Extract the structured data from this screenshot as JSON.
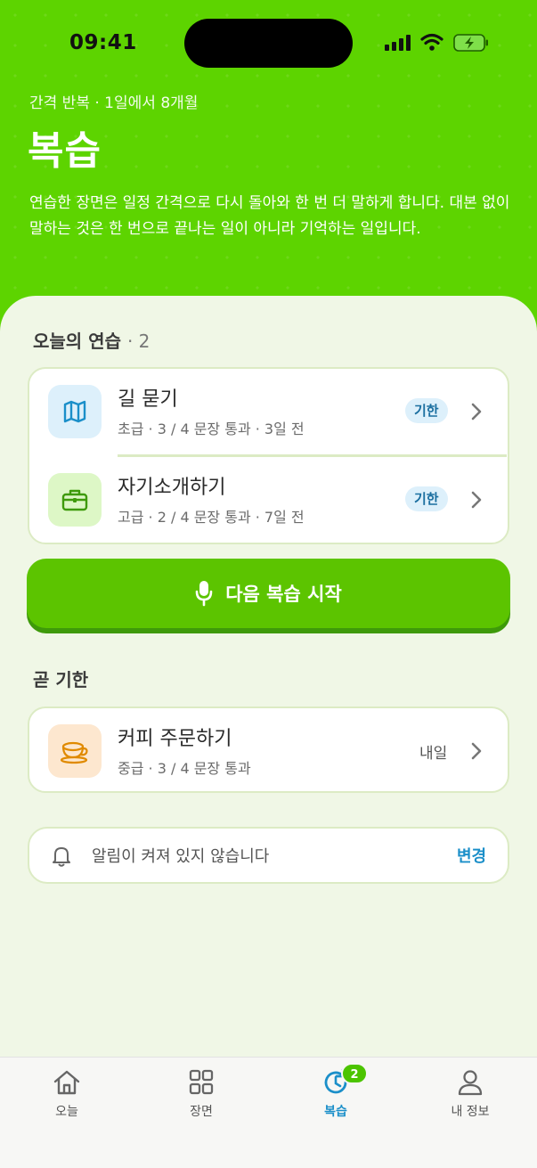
{
  "status": {
    "time": "09:41"
  },
  "header": {
    "eyebrow": "간격 반복 · 1일에서 8개월",
    "title": "복습",
    "description": "연습한 장면은 일정 간격으로 다시 돌아와 한 번 더 말하게 합니다. 대본 없이 말하는 것은 한 번으로 끝나는 일이 아니라 기억하는 일입니다."
  },
  "today": {
    "title": "오늘의 연습",
    "count": "· 2",
    "items": [
      {
        "icon": "map-icon",
        "title": "길 묻기",
        "subtitle": "초급 · 3 / 4 문장 통과 · 3일 전",
        "badge": "기한",
        "icon_bg": "#DDF0FB",
        "icon_color": "#1B8FC9"
      },
      {
        "icon": "briefcase-icon",
        "title": "자기소개하기",
        "subtitle": "고급 · 2 / 4 문장 통과 · 7일 전",
        "badge": "기한",
        "icon_bg": "#DDF7C6",
        "icon_color": "#3E9A0A"
      }
    ]
  },
  "cta": {
    "label": "다음 복습 시작",
    "icon": "mic-icon"
  },
  "soon": {
    "title": "곧 기한",
    "items": [
      {
        "icon": "coffee-icon",
        "title": "커피 주문하기",
        "subtitle": "중급 · 3 / 4 문장 통과",
        "when": "내일",
        "icon_bg": "#FDE7CF",
        "icon_color": "#E08A00"
      }
    ]
  },
  "notification": {
    "icon": "bell-icon",
    "text": "알림이 켜져 있지 않습니다",
    "action": "변경"
  },
  "tabs": [
    {
      "icon": "home-icon",
      "label": "오늘",
      "active": false
    },
    {
      "icon": "grid-icon",
      "label": "장면",
      "active": false
    },
    {
      "icon": "review-icon",
      "label": "복습",
      "active": true,
      "badge": "2"
    },
    {
      "icon": "person-icon",
      "label": "내 정보",
      "active": false
    }
  ],
  "colors": {
    "hero": "#5DD400",
    "accent": "#5CC400",
    "link": "#1B8FC9",
    "background": "#F0F7E6"
  }
}
